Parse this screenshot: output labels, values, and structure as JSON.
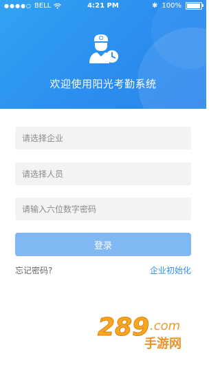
{
  "status_bar": {
    "carrier": "BELL",
    "time": "4:21 PM",
    "battery": "100%"
  },
  "header": {
    "welcome": "欢迎使用阳光考勤系统"
  },
  "form": {
    "company_placeholder": "请选择企业",
    "staff_placeholder": "请选择人员",
    "password_placeholder": "请输入六位数字密码"
  },
  "actions": {
    "login": "登录",
    "forgot": "忘记密码?",
    "init": "企业初始化"
  },
  "watermark": {
    "brand": "289",
    "suffix": ".com",
    "sub": "手游网"
  },
  "colors": {
    "header": "#2b8ef0",
    "button": "#7fb8f2",
    "link": "#2d8df0"
  }
}
